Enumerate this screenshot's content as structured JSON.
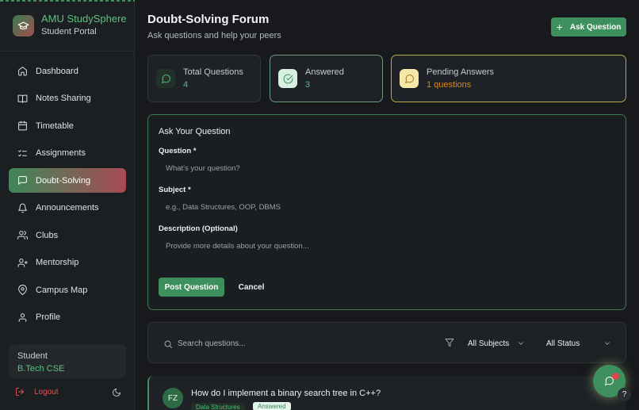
{
  "brand": {
    "title": "AMU StudySphere",
    "subtitle": "Student Portal"
  },
  "sidebar": {
    "items": [
      {
        "label": "Dashboard",
        "icon": "home-icon"
      },
      {
        "label": "Notes Sharing",
        "icon": "book-icon"
      },
      {
        "label": "Timetable",
        "icon": "calendar-icon"
      },
      {
        "label": "Assignments",
        "icon": "checklist-icon"
      },
      {
        "label": "Doubt-Solving",
        "icon": "chat-icon",
        "active": true
      },
      {
        "label": "Announcements",
        "icon": "bell-icon"
      },
      {
        "label": "Clubs",
        "icon": "users-icon"
      },
      {
        "label": "Mentorship",
        "icon": "user-plus-icon"
      },
      {
        "label": "Campus Map",
        "icon": "map-pin-icon"
      },
      {
        "label": "Profile",
        "icon": "user-icon"
      }
    ],
    "user": {
      "role": "Student",
      "program": "B.Tech CSE"
    },
    "logout_label": "Logout"
  },
  "header": {
    "title": "Doubt-Solving Forum",
    "subtitle": "Ask questions and help your peers",
    "ask_button": "Ask Question"
  },
  "stats": [
    {
      "label": "Total Questions",
      "value": "4"
    },
    {
      "label": "Answered",
      "value": "3"
    },
    {
      "label": "Pending Answers",
      "value": "1 questions"
    }
  ],
  "form": {
    "heading": "Ask Your Question",
    "question_label": "Question *",
    "question_placeholder": "What's your question?",
    "subject_label": "Subject *",
    "subject_placeholder": "e.g., Data Structures, OOP, DBMS",
    "description_label": "Description (Optional)",
    "description_placeholder": "Provide more details about your question...",
    "post_button": "Post Question",
    "cancel_button": "Cancel"
  },
  "filters": {
    "search_placeholder": "Search questions...",
    "subject_select": "All Subjects",
    "status_select": "All Status"
  },
  "questions": [
    {
      "initials": "FZ",
      "title": "How do I implement a binary search tree in C++?",
      "subject": "Data Structures",
      "status": "Answered"
    }
  ],
  "colors": {
    "accent": "#3d8f5d",
    "brand_green": "#5cc27f",
    "pending": "#d88a1d",
    "danger": "#e0554f"
  },
  "help_label": "?"
}
